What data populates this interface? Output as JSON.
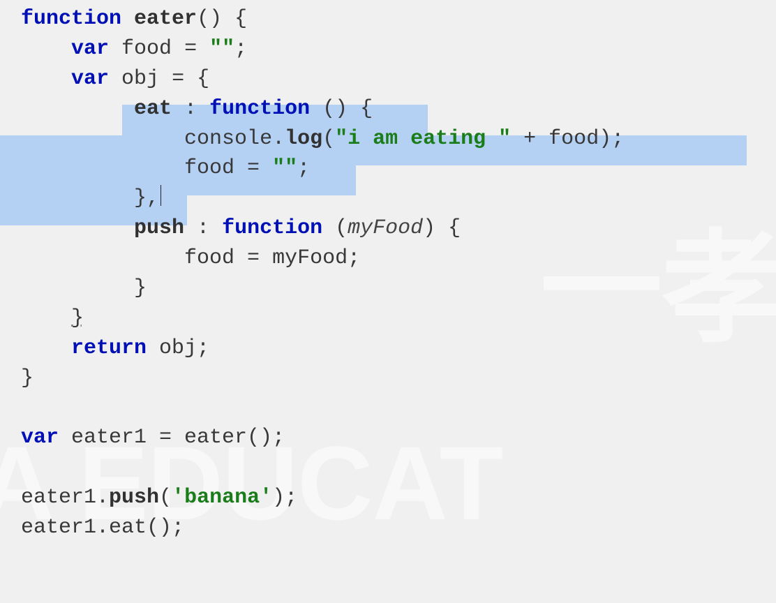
{
  "watermark": {
    "cn_fragment": "一孝",
    "edu_fragment": "A EDUCAT"
  },
  "code": {
    "l1": {
      "kw1": "function",
      "name": "eater",
      "rest": "() {"
    },
    "l2": {
      "kw": "var",
      "id": "food",
      "eq": " = ",
      "str": "\"\"",
      "semi": ";"
    },
    "l3": {
      "kw": "var",
      "id": "obj",
      "eq": " = {"
    },
    "l4": {
      "key": "eat",
      "colon": " : ",
      "kw": "function",
      "rest": " () {"
    },
    "l5": {
      "obj": "console",
      "dot": ".",
      "method": "log",
      "open": "(",
      "str": "\"i am eating \"",
      "plus": " + food);",
      "rparen": ""
    },
    "l6": {
      "lhs": "food = ",
      "str": "\"\"",
      "semi": ";"
    },
    "l7": {
      "close": "},"
    },
    "l8": {
      "key": "push",
      "colon": " : ",
      "kw": "function",
      "rest": " (",
      "param": "myFood",
      "rest2": ") {"
    },
    "l9": {
      "body": "food = myFood;"
    },
    "l10": {
      "close": "}"
    },
    "l11": {
      "close": "}"
    },
    "l12": {
      "kw": "return",
      "rest": " obj;"
    },
    "l13": {
      "close": "}"
    },
    "l15": {
      "kw": "var",
      "rest": " eater1 = eater();"
    },
    "l17": {
      "obj": "eater1.",
      "method": "push",
      "open": "(",
      "str": "'banana'",
      "close": ");"
    },
    "l18": {
      "stmt": "eater1.eat();"
    }
  }
}
